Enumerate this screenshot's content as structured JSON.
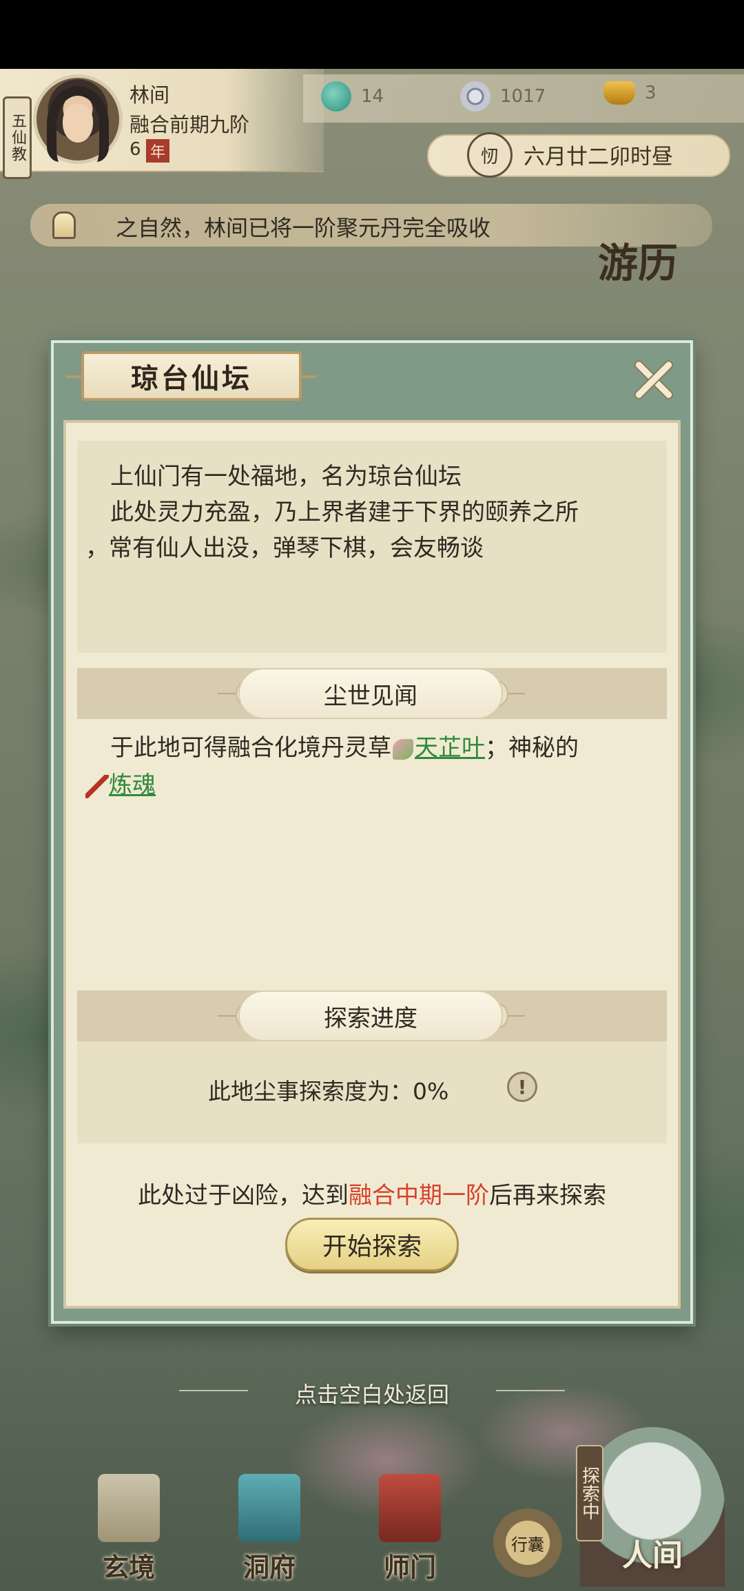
{
  "player": {
    "sect": "五仙教",
    "name": "林间",
    "realm": "融合前期九阶",
    "age": "6",
    "age_unit": "年"
  },
  "resources": [
    {
      "icon": "jade-icon",
      "value": "14"
    },
    {
      "icon": "coin-icon",
      "value": "1017"
    },
    {
      "icon": "ingot-icon",
      "value": "3"
    }
  ],
  "time": {
    "badge": "㣼",
    "text": "六月廿二卯时昼"
  },
  "notice": {
    "text": "之自然，林间已将一阶聚元丹完全吸收"
  },
  "travel_badge": "游历",
  "dialog": {
    "title": "琼台仙坛",
    "description": [
      "上仙门有一处福地，名为琼台仙坛",
      "此处灵力充盈，乃上界者建于下界的颐养之所",
      "，常有仙人出没，弹琴下棋，会友畅谈"
    ],
    "loot_section": {
      "title": "尘世见闻",
      "line1_prefix": "于此地可得融合化境丹灵草",
      "item1": "天芷叶",
      "line1_suffix": "；神秘的",
      "item2": "炼魂"
    },
    "progress_section": {
      "title": "探索进度",
      "label": "此地尘事探索度为：0%",
      "info": "!"
    },
    "warning": {
      "prefix": "此处过于凶险，达到",
      "requirement": "融合中期一阶",
      "suffix": "后再来探索"
    },
    "explore_button": "开始探索"
  },
  "return_hint": "点击空白处返回",
  "bottom_nav": {
    "items": [
      {
        "label": "玄境"
      },
      {
        "label": "洞府"
      },
      {
        "label": "师门"
      }
    ],
    "bag": "行囊",
    "exploring": "探索中",
    "world": "人间"
  },
  "colors": {
    "requirement_red": "#d6412a",
    "item_green": "#2e8a3a",
    "dialog_frame": "#7f9a86",
    "parchment": "#f1ead3"
  }
}
